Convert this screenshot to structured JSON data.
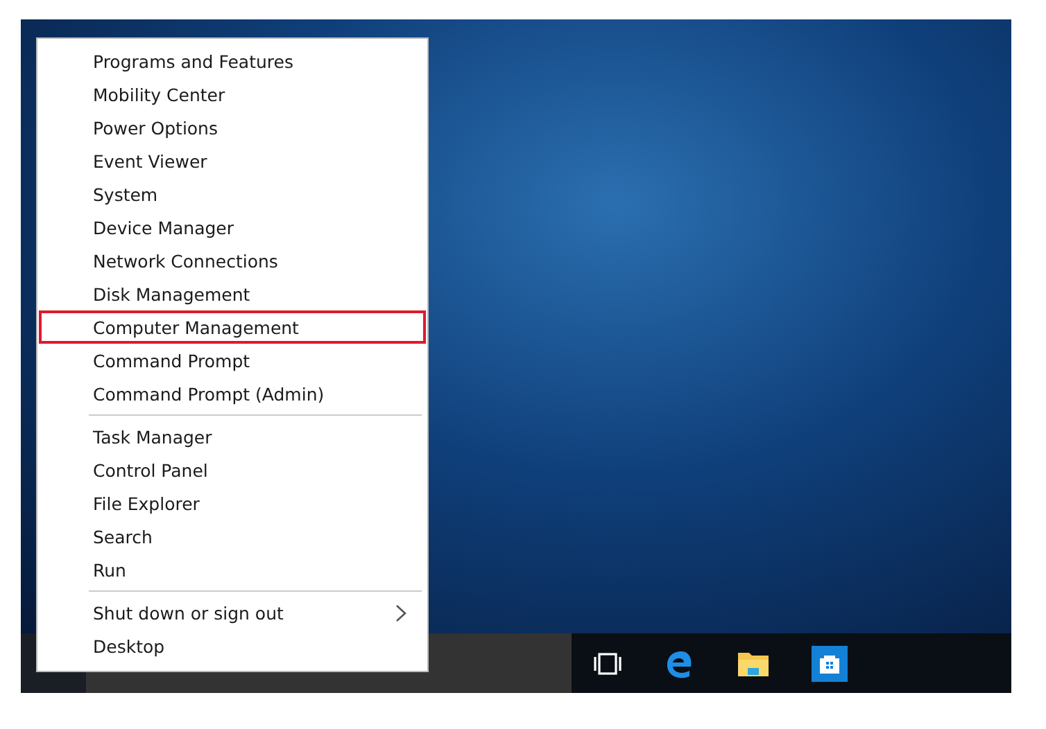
{
  "menu": {
    "groups": [
      [
        {
          "label": "Programs and Features",
          "kind": "plain",
          "highlighted": false
        },
        {
          "label": "Mobility Center",
          "kind": "plain",
          "highlighted": false
        },
        {
          "label": "Power Options",
          "kind": "plain",
          "highlighted": false
        },
        {
          "label": "Event Viewer",
          "kind": "plain",
          "highlighted": false
        },
        {
          "label": "System",
          "kind": "plain",
          "highlighted": false
        },
        {
          "label": "Device Manager",
          "kind": "plain",
          "highlighted": false
        },
        {
          "label": "Network Connections",
          "kind": "plain",
          "highlighted": false
        },
        {
          "label": "Disk Management",
          "kind": "plain",
          "highlighted": false
        },
        {
          "label": "Computer Management",
          "kind": "plain",
          "highlighted": true
        },
        {
          "label": "Command Prompt",
          "kind": "plain",
          "highlighted": false
        },
        {
          "label": "Command Prompt (Admin)",
          "kind": "plain",
          "highlighted": false
        }
      ],
      [
        {
          "label": "Task Manager",
          "kind": "plain",
          "highlighted": false
        },
        {
          "label": "Control Panel",
          "kind": "plain",
          "highlighted": false
        },
        {
          "label": "File Explorer",
          "kind": "plain",
          "highlighted": false
        },
        {
          "label": "Search",
          "kind": "plain",
          "highlighted": false
        },
        {
          "label": "Run",
          "kind": "plain",
          "highlighted": false
        }
      ],
      [
        {
          "label": "Shut down or sign out",
          "kind": "submenu",
          "highlighted": false
        },
        {
          "label": "Desktop",
          "kind": "plain",
          "highlighted": false
        }
      ]
    ]
  }
}
